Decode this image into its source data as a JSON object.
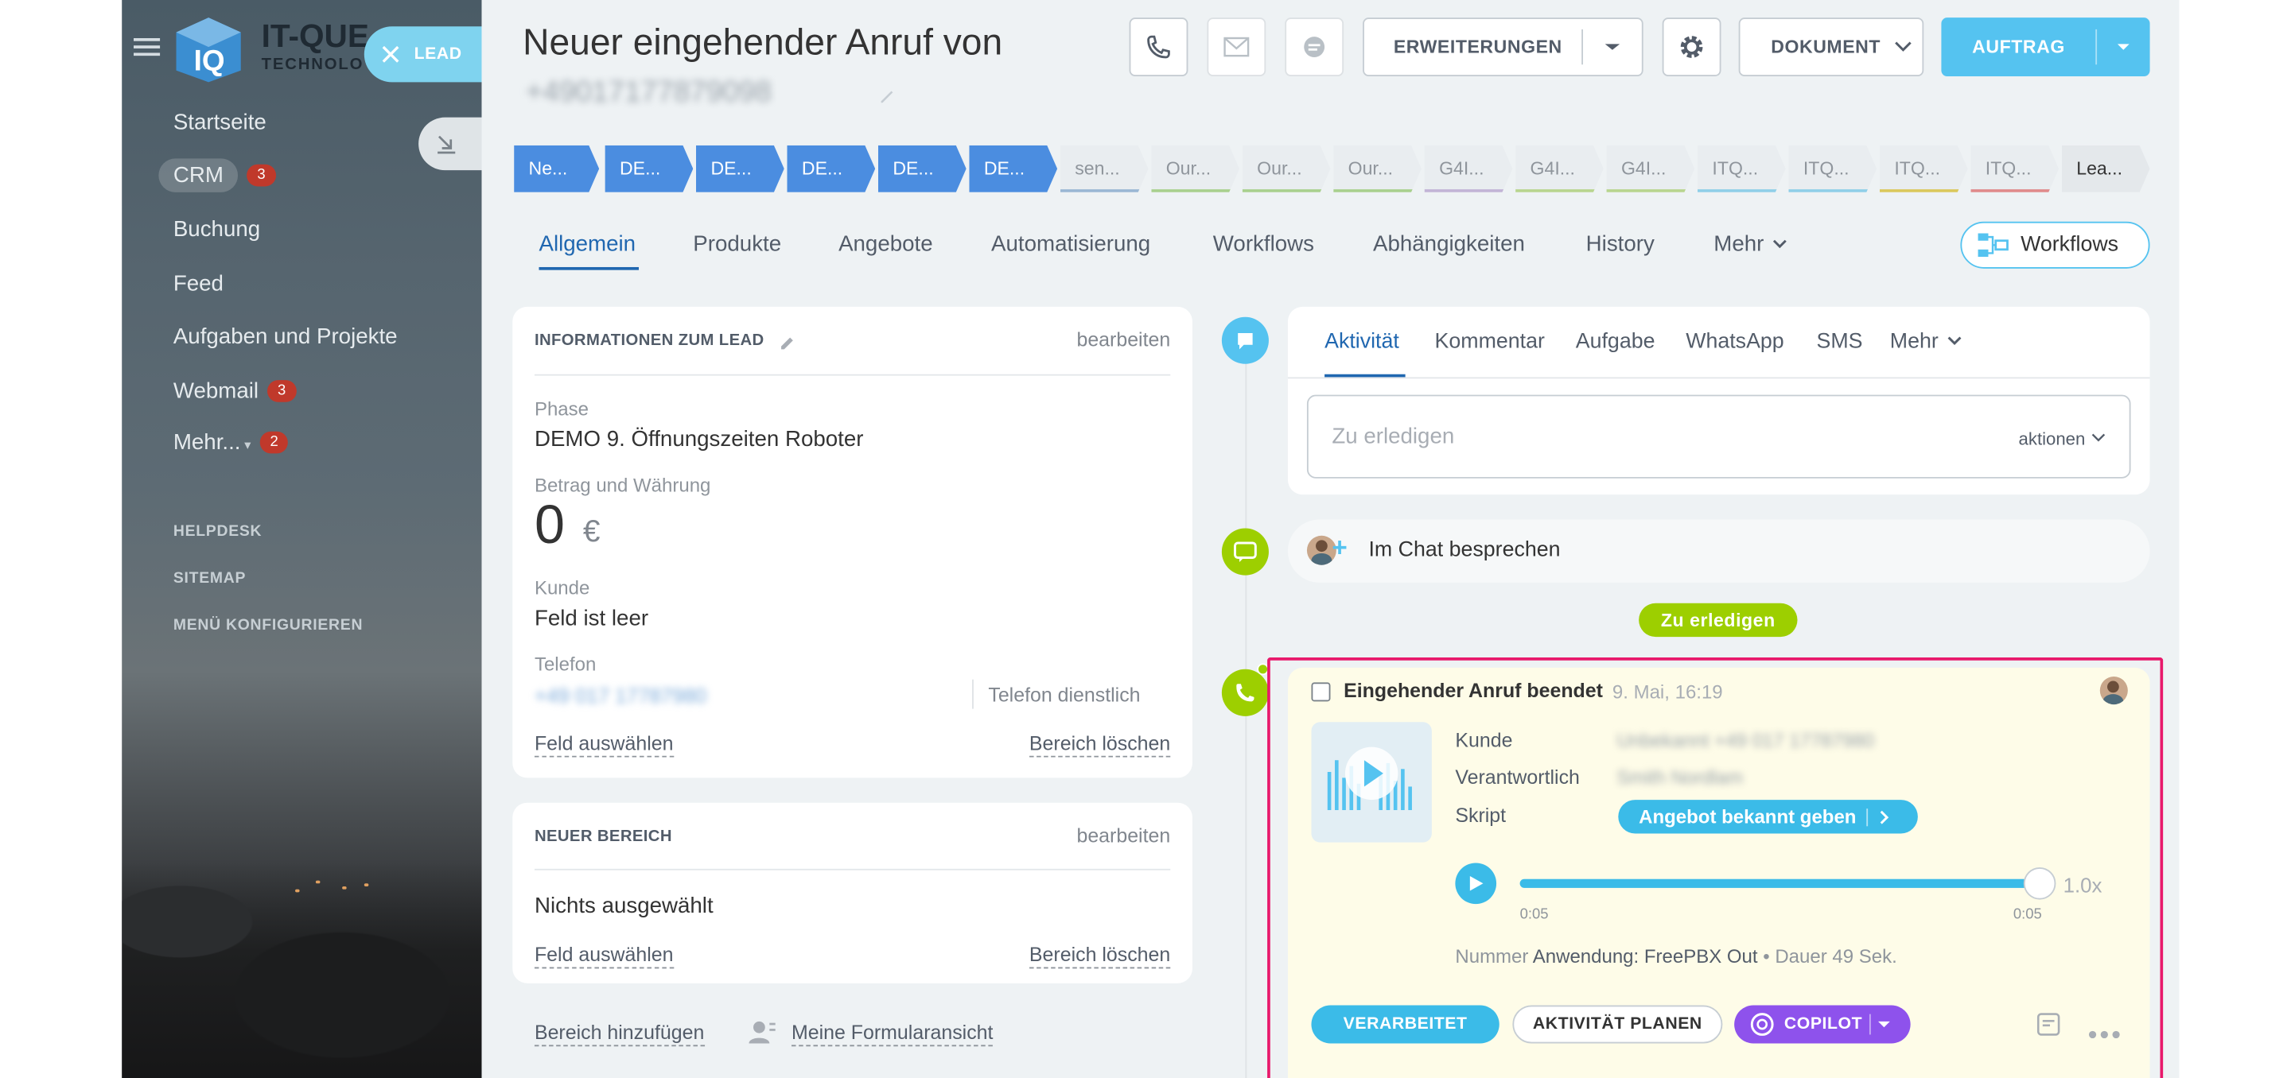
{
  "colors": {
    "accent": "#3bc8f5",
    "primary": "#5a9be0",
    "green": "#9dcf00",
    "magenta": "#e8196b",
    "purple": "#8e52ec"
  },
  "sidebar": {
    "logo_text": "IT-QUE",
    "logo_sub": "TECHNOLO",
    "lead_button": "LEAD",
    "items": [
      {
        "label": "Startseite"
      },
      {
        "label": "CRM",
        "badge": "3"
      },
      {
        "label": "Buchung"
      },
      {
        "label": "Feed"
      },
      {
        "label": "Aufgaben und Projekte"
      },
      {
        "label": "Webmail",
        "badge": "3"
      },
      {
        "label": "Mehr...",
        "badge": "2"
      }
    ],
    "small_items": [
      "HELPDESK",
      "SITEMAP",
      "MENÜ KONFIGURIEREN"
    ]
  },
  "header": {
    "title": "Neuer eingehender Anruf von",
    "phone_blurred": "+49017177879098",
    "buttons": {
      "erweiterungen": "ERWEITERUNGEN",
      "dokument": "DOKUMENT",
      "auftrag": "AUFTRAG"
    }
  },
  "stages": [
    "Ne...",
    "DE...",
    "DE...",
    "DE...",
    "DE...",
    "DE...",
    "sen...",
    "Our...",
    "Our...",
    "Our...",
    "G4I...",
    "G4I...",
    "G4I...",
    "ITQ...",
    "ITQ...",
    "ITQ...",
    "ITQ...",
    "Lea..."
  ],
  "tabs": [
    "Allgemein",
    "Produkte",
    "Angebote",
    "Automatisierung",
    "Workflows",
    "Abhängigkeiten",
    "History",
    "Mehr"
  ],
  "workflows_button": "Workflows",
  "lead_info": {
    "title": "INFORMATIONEN ZUM LEAD",
    "edit": "bearbeiten",
    "phase_label": "Phase",
    "phase_value": "DEMO 9. Öffnungszeiten Roboter",
    "amount_label": "Betrag und Währung",
    "amount_value": "0",
    "currency": "€",
    "client_label": "Kunde",
    "client_value": "Feld ist leer",
    "phone_label": "Telefon",
    "phone_value": "+49 017 17787980",
    "phone_type": "Telefon dienstlich",
    "select_field": "Feld auswählen",
    "delete_area": "Bereich löschen"
  },
  "new_area": {
    "title": "NEUER BEREICH",
    "edit": "bearbeiten",
    "value": "Nichts ausgewählt",
    "select_field": "Feld auswählen",
    "delete_area": "Bereich löschen"
  },
  "bottom_links": {
    "add_area": "Bereich hinzufügen",
    "my_form": "Meine Formularansicht"
  },
  "activity": {
    "tabs": [
      "Aktivität",
      "Kommentar",
      "Aufgabe",
      "WhatsApp",
      "SMS",
      "Mehr"
    ],
    "input_placeholder": "Zu erledigen",
    "actions": "aktionen",
    "chat_discuss": "Im Chat besprechen",
    "todo_badge": "Zu erledigen"
  },
  "call": {
    "title": "Eingehender Anruf beendet",
    "date": "9. Mai, 16:19",
    "kunde_label": "Kunde",
    "kunde_value": "Unbekannt +49 017 17787980",
    "verantwortlich_label": "Verantwortlich",
    "verantwortlich_value": "Smith Nordlam",
    "skript_label": "Skript",
    "skript_value": "Angebot bekannt geben",
    "time_start": "0:05",
    "time_end": "0:05",
    "speed": "1.0x",
    "progress": 1.0,
    "nummer_label": "Nummer",
    "nummer_app": "Anwendung: FreePBX Out",
    "dauer": "Dauer 49 Sek.",
    "btn_verarbeitet": "VERARBEITET",
    "btn_planen": "AKTIVITÄT PLANEN",
    "btn_copilot": "COPILOT"
  }
}
